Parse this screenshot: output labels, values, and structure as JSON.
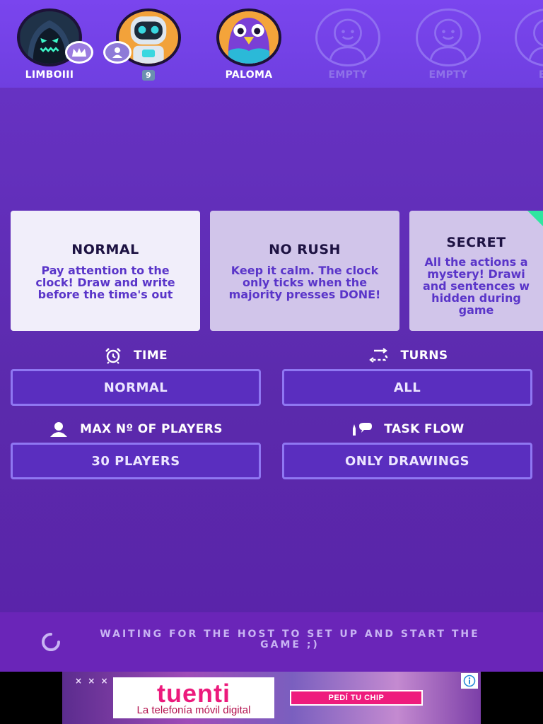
{
  "players": [
    {
      "name": "LIMBOIII",
      "avatar_icon": "skull-hood-icon",
      "badge": "crown-icon"
    },
    {
      "name": "",
      "number_badge": "9",
      "avatar_icon": "robot-icon",
      "badge": "user-icon"
    },
    {
      "name": "PALOMA",
      "avatar_icon": "pigeon-icon"
    },
    {
      "name": "EMPTY",
      "avatar_icon": "empty-avatar-icon"
    },
    {
      "name": "EMPTY",
      "avatar_icon": "empty-avatar-icon"
    },
    {
      "name": "EM",
      "avatar_icon": "empty-avatar-icon"
    }
  ],
  "modes": [
    {
      "title": "NORMAL",
      "description": "Pay attention to the clock! Draw and write before the time's out",
      "selected": true
    },
    {
      "title": "NO RUSH",
      "description": "Keep it calm. The clock only ticks when the majority presses DONE!",
      "selected": false
    },
    {
      "title": "SECRET",
      "description": "All the actions a mystery! Drawi and sentences w hidden during game",
      "selected": false
    }
  ],
  "settings": {
    "time": {
      "label": "TIME",
      "value": "NORMAL",
      "icon": "alarm-clock-icon"
    },
    "turns": {
      "label": "TURNS",
      "value": "ALL",
      "icon": "turns-flow-icon"
    },
    "max_players": {
      "label": "MAX Nº OF PLAYERS",
      "value": "30 PLAYERS",
      "icon": "user-icon"
    },
    "task_flow": {
      "label": "TASK FLOW",
      "value": "ONLY DRAWINGS",
      "icon": "brush-speech-icon"
    }
  },
  "status": {
    "text": "WAITING FOR THE HOST TO SET UP AND START THE GAME ;)",
    "icon": "spinner-icon"
  },
  "ad": {
    "marks": "× × ×",
    "brand": "tuenti",
    "tagline": "La telefonía móvil digital",
    "cta": "PEDÍ TU CHIP",
    "info_icon": "info-icon"
  },
  "colors": {
    "background": "#5b2aac",
    "players_bar": "#7a45ee",
    "accent_green": "#2fe6a0",
    "card_selected": "#f1eefa",
    "card_other": "#d1c5ea"
  }
}
